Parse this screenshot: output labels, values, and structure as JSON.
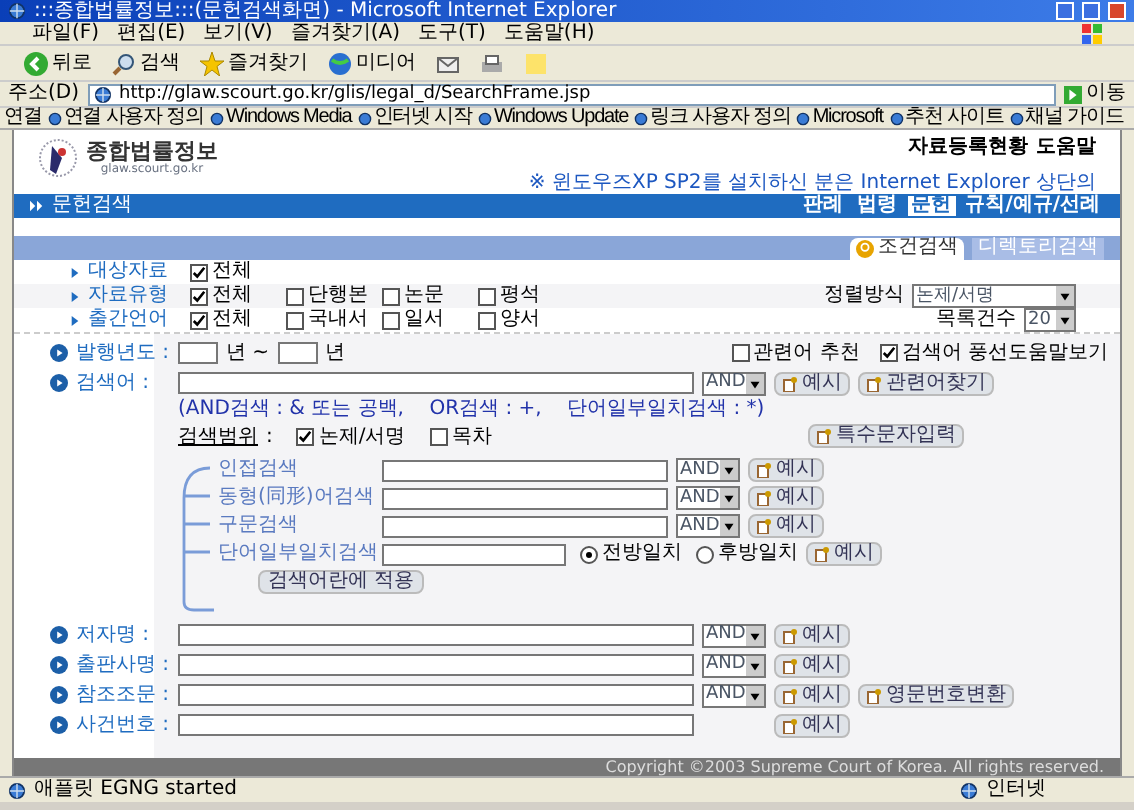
{
  "window": {
    "title": ":::종합법률정보:::(문헌검색화면) - Microsoft Internet Explorer"
  },
  "menu": [
    "파일(F)",
    "편집(E)",
    "보기(V)",
    "즐겨찾기(A)",
    "도구(T)",
    "도움말(H)"
  ],
  "toolbar": [
    {
      "kind": "back",
      "label": "뒤로"
    },
    {
      "kind": "search",
      "label": "검색"
    },
    {
      "kind": "favorites",
      "label": "즐겨찾기"
    },
    {
      "kind": "media",
      "label": "미디어"
    }
  ],
  "address": {
    "label": "주소(D)",
    "url": "http://glaw.scourt.go.kr/glis/legal_d/SearchFrame.jsp",
    "go": "이동"
  },
  "links": {
    "label": "연결",
    "items": [
      "연결 사용자 정의",
      "Windows Media",
      "인터넷 시작",
      "Windows Update",
      "링크 사용자 정의",
      "Microsoft",
      "추천 사이트",
      "채널 가이드"
    ]
  },
  "site": {
    "title": "종합법률정보",
    "domain": "glaw.scourt.go.kr",
    "top_links": [
      "자료등록현황",
      "도움말"
    ],
    "notice": "※ 윈도우즈XP SP2를 설치하신 분은 Internet Explorer 상단의"
  },
  "nav": {
    "section": "문헌검색",
    "tabs": [
      {
        "label": "판례",
        "selected": false
      },
      {
        "label": "법령",
        "selected": false
      },
      {
        "label": "문헌",
        "selected": true
      },
      {
        "label": "규칙/예규/선례",
        "selected": false
      }
    ]
  },
  "search_tabs": [
    {
      "label": "조건검색",
      "selected": true
    },
    {
      "label": "디렉토리검색",
      "selected": false
    }
  ],
  "filters": [
    {
      "label": "대상자료",
      "options": [
        {
          "label": "전체",
          "checked": true
        }
      ]
    },
    {
      "label": "자료유형",
      "options": [
        {
          "label": "전체",
          "checked": true
        },
        {
          "label": "단행본",
          "checked": false
        },
        {
          "label": "논문",
          "checked": false
        },
        {
          "label": "평석",
          "checked": false
        }
      ],
      "setting": {
        "label": "정렬방식",
        "value": "논제/서명"
      }
    },
    {
      "label": "출간언어",
      "options": [
        {
          "label": "전체",
          "checked": true
        },
        {
          "label": "국내서",
          "checked": false
        },
        {
          "label": "일서",
          "checked": false
        },
        {
          "label": "양서",
          "checked": false
        }
      ],
      "setting": {
        "label": "목록건수",
        "value": "20"
      }
    }
  ],
  "year": {
    "label": "발행년도 :",
    "from_unit": "년 ~",
    "to_unit": "년",
    "options": [
      {
        "label": "관련어 추천",
        "checked": false
      },
      {
        "label": "검색어 풍선도움말보기",
        "checked": true
      }
    ]
  },
  "keyword": {
    "label": "검색어 :",
    "operator": "AND",
    "example": "예시",
    "related": "관련어찾기",
    "hint": "(AND검색 : & 또는 공백,    OR검색 : +,    단어일부일치검색 : *)",
    "scope_label": "검색범위",
    "scope_sep": ":",
    "scope": [
      {
        "label": "논제/서명",
        "checked": true
      },
      {
        "label": "목차",
        "checked": false
      }
    ],
    "special": "특수문자입력"
  },
  "sub_searches": [
    {
      "kind": "operator",
      "label": "인접검색",
      "operator": "AND",
      "example": "예시"
    },
    {
      "kind": "operator",
      "label": "동형(同形)어검색",
      "operator": "AND",
      "example": "예시"
    },
    {
      "kind": "operator",
      "label": "구문검색",
      "operator": "AND",
      "example": "예시"
    },
    {
      "kind": "radio",
      "label": "단어일부일치검색",
      "radios": [
        {
          "label": "전방일치",
          "selected": true
        },
        {
          "label": "후방일치",
          "selected": false
        }
      ],
      "example": "예시"
    }
  ],
  "apply": "검색어란에 적용",
  "fields": [
    {
      "label": "저자명 :",
      "operator": "AND",
      "example": "예시"
    },
    {
      "label": "출판사명 :",
      "operator": "AND",
      "example": "예시"
    },
    {
      "label": "참조조문 :",
      "operator": "AND",
      "example": "예시",
      "extra": "영문번호변환"
    },
    {
      "label": "사건번호 :",
      "example": "예시"
    }
  ],
  "copyright": "Copyright ©2003 Supreme Court of Korea. All rights reserved.",
  "status": {
    "text": "애플릿 EGNG started",
    "zone": "인터넷"
  }
}
